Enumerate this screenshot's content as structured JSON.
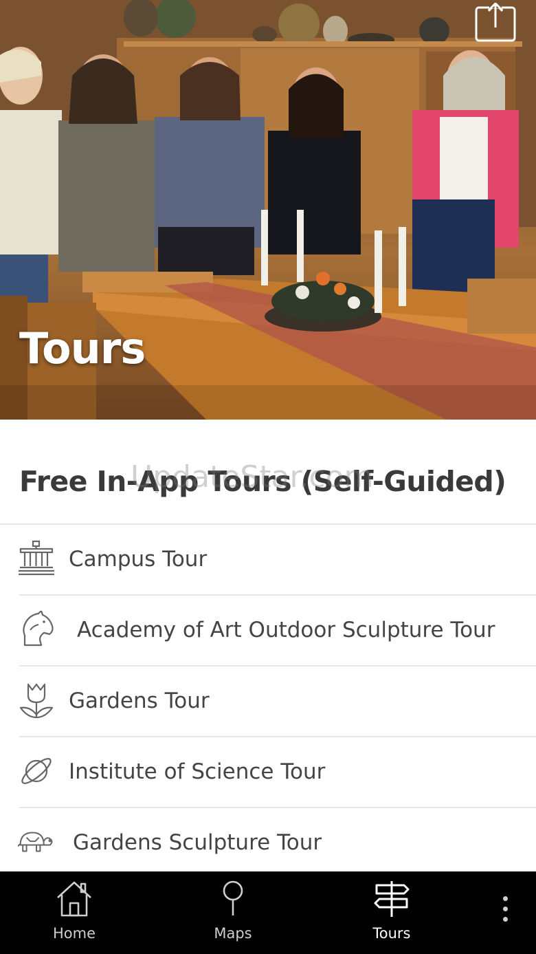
{
  "hero": {
    "title": "Tours"
  },
  "section": {
    "title": "Free In-App Tours (Self-Guided)",
    "watermark": "UpdateStar.com"
  },
  "tours": [
    {
      "label": "Campus Tour",
      "icon": "building-columns-icon"
    },
    {
      "label": "Academy of Art Outdoor Sculpture Tour",
      "icon": "horse-head-icon"
    },
    {
      "label": "Gardens Tour",
      "icon": "tulip-icon"
    },
    {
      "label": "Institute of Science Tour",
      "icon": "planet-icon"
    },
    {
      "label": "Gardens Sculpture Tour",
      "icon": "turtle-icon"
    }
  ],
  "nav": {
    "home": "Home",
    "maps": "Maps",
    "tours": "Tours",
    "active": "tours"
  },
  "colors": {
    "nav_bg": "#000000",
    "text": "#444444",
    "heading": "#3a3a3a"
  }
}
